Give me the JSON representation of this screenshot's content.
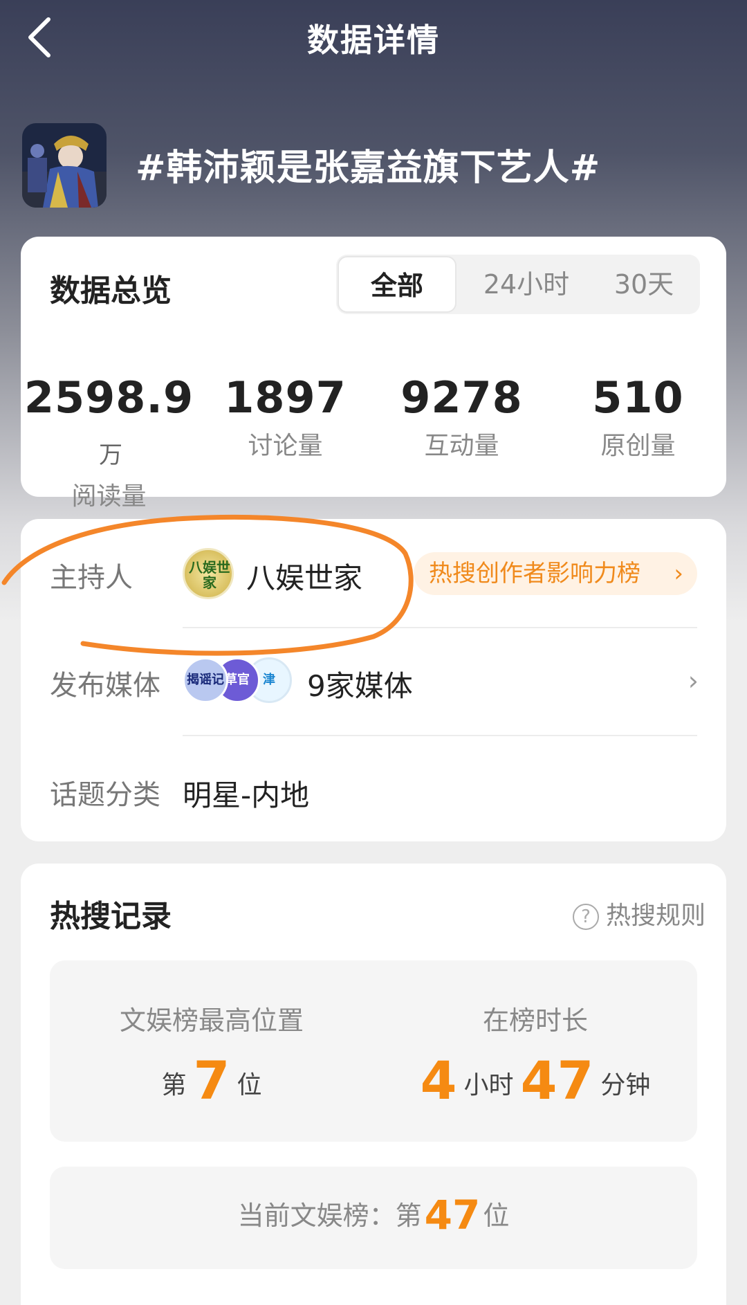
{
  "header": {
    "title": "数据详情",
    "back_icon": "chevron-left-icon"
  },
  "topic": {
    "title": "#韩沛颖是张嘉益旗下艺人#"
  },
  "overview": {
    "title": "数据总览",
    "tabs": [
      "全部",
      "24小时",
      "30天"
    ],
    "active_tab": "全部",
    "stats": [
      {
        "value": "2598.9",
        "unit": "万",
        "label": "阅读量"
      },
      {
        "value": "1897",
        "unit": "",
        "label": "讨论量"
      },
      {
        "value": "9278",
        "unit": "",
        "label": "互动量"
      },
      {
        "value": "510",
        "unit": "",
        "label": "原创量"
      }
    ]
  },
  "info": {
    "host_label": "主持人",
    "host_name": "八娱世家",
    "host_avatar_text": "八娱世家",
    "rank_badge": "热搜创作者影响力榜",
    "rank_badge_chevron": "›",
    "media_label": "发布媒体",
    "media_count": "9家媒体",
    "media_avatars": [
      "揭谣记",
      "草官",
      "津"
    ],
    "media_chevron": "›",
    "category_label": "话题分类",
    "category_value": "明星-内地"
  },
  "hot": {
    "title": "热搜记录",
    "rules_label": "热搜规则",
    "help_icon_glyph": "?",
    "peak_label": "文娱榜最高位置",
    "peak_prefix": "第",
    "peak_value": "7",
    "peak_suffix": "位",
    "duration_label": "在榜时长",
    "duration_hours": "4",
    "hours_unit": "小时",
    "duration_minutes": "47",
    "minutes_unit": "分钟",
    "current_label": "当前文娱榜：",
    "current_prefix": "第",
    "current_value": "47",
    "current_suffix": "位"
  },
  "colors": {
    "accent_orange": "#f58a12",
    "annotation_orange": "#f4862a",
    "badge_bg": "#fff2e4"
  }
}
